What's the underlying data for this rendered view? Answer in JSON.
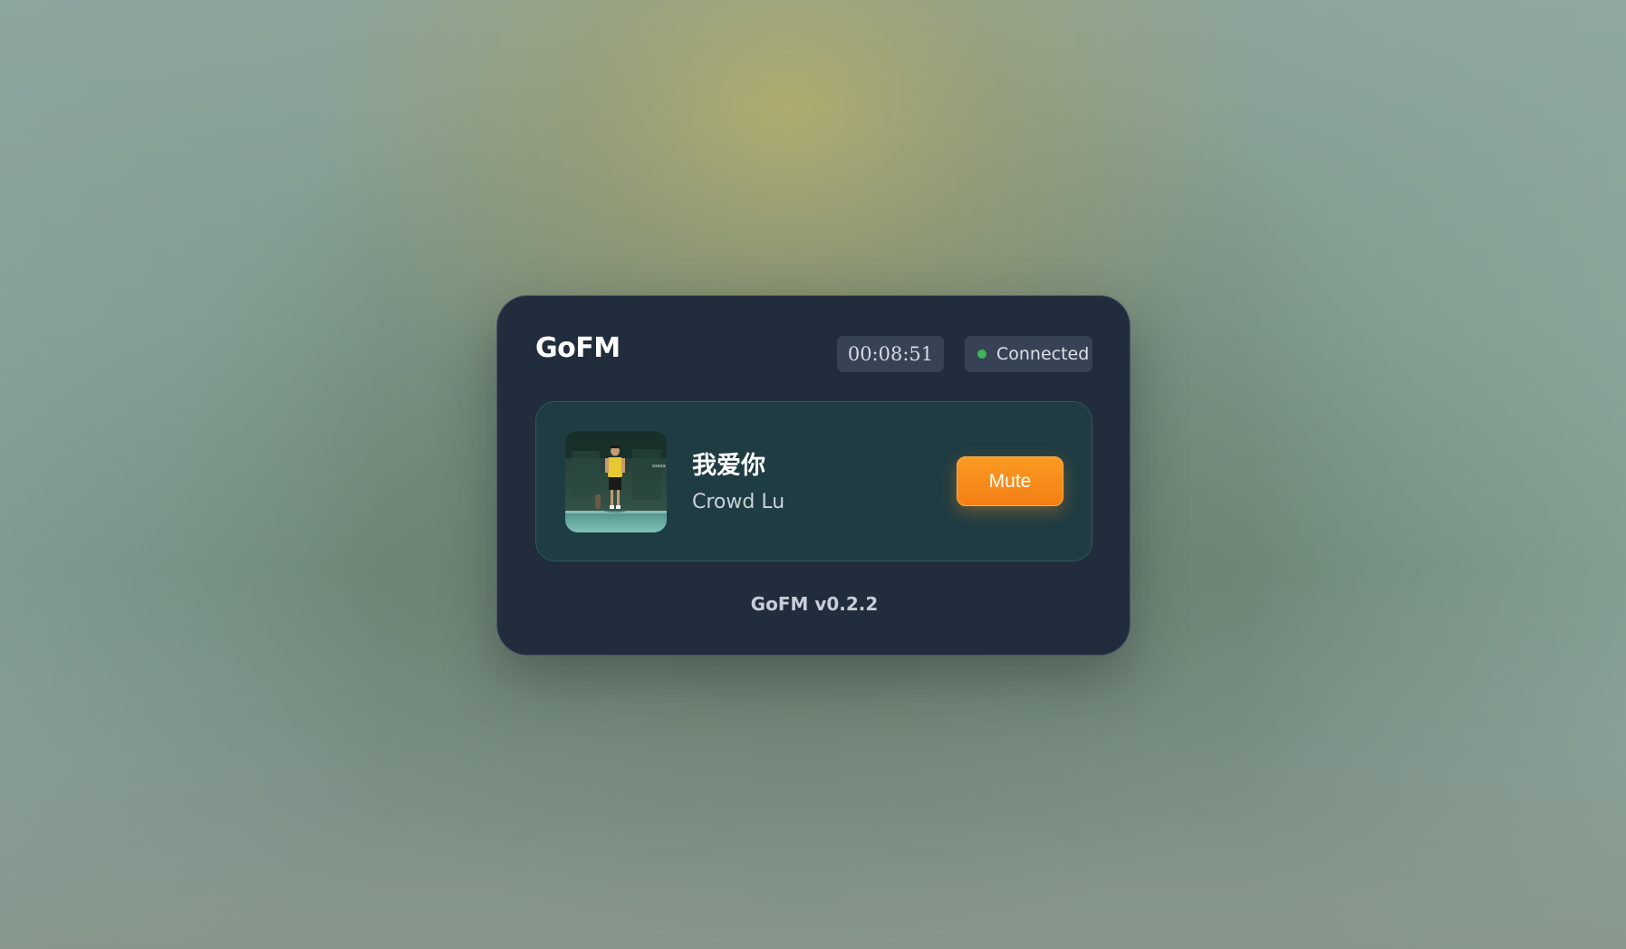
{
  "app": {
    "title": "GoFM",
    "version_label": "GoFM v0.2.2"
  },
  "header": {
    "timer": "00:08:51",
    "status": {
      "label": "Connected",
      "color": "#3fb45a"
    }
  },
  "now_playing": {
    "song_title": "我爱你",
    "artist": "Crowd Lu",
    "album_art_icon": "album-cover-image",
    "mute_label": "Mute"
  },
  "colors": {
    "accent": "#f48c1a",
    "card_bg": "#212d3d",
    "panel_bg": "#1f3c43"
  }
}
